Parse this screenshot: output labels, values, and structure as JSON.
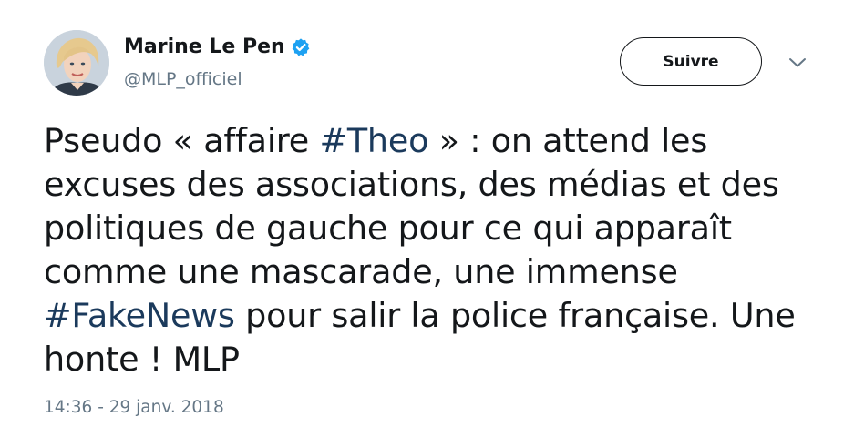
{
  "user": {
    "display_name": "Marine Le Pen",
    "handle": "@MLP_officiel",
    "verified": true,
    "verified_icon": "verified-badge-icon",
    "avatar_icon": "profile-photo"
  },
  "actions": {
    "follow_label": "Suivre",
    "menu_icon": "chevron-down-icon"
  },
  "tweet": {
    "lines": [
      [
        "Pseudo « affaire ",
        "#Theo",
        " » : on attend les"
      ],
      [
        "excuses des associations, des médias et des"
      ],
      [
        "politiques de gauche pour ce qui apparaît"
      ],
      [
        "comme une mascarade, une immense"
      ],
      [
        "",
        "#FakeNews",
        " pour salir la police française. Une"
      ],
      [
        "honte ! MLP"
      ]
    ],
    "timestamp": "14:36 - 29 janv. 2018"
  },
  "colors": {
    "text": "#14171a",
    "secondary": "#657786",
    "hashtag": "#1b3a5c",
    "verified": "#1da1f2"
  }
}
